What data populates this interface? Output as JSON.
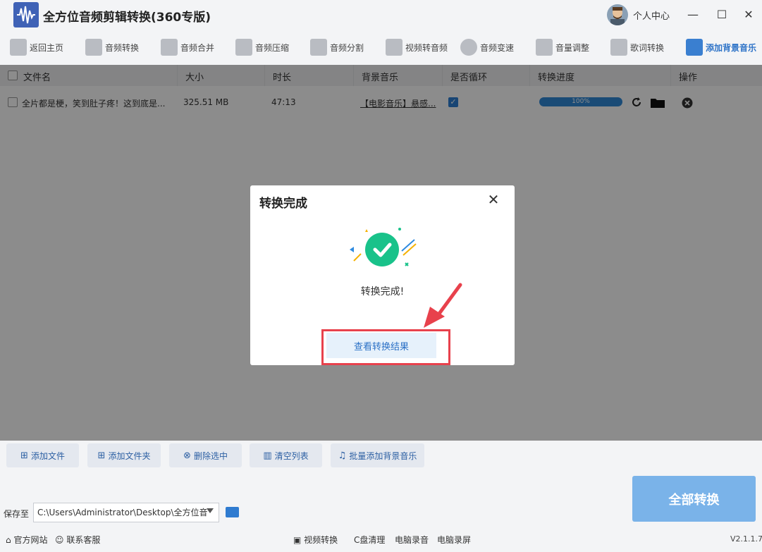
{
  "app": {
    "title": "全方位音频剪辑转换(360专版)",
    "user_center": "个人中心"
  },
  "toolbar": {
    "items": [
      "返回主页",
      "音频转换",
      "音频合并",
      "音频压缩",
      "音频分割",
      "视频转音频",
      "音频变速",
      "音量调整",
      "歌词转换",
      "添加背景音乐"
    ],
    "active_index": 9
  },
  "table": {
    "headers": [
      "文件名",
      "大小",
      "时长",
      "背景音乐",
      "是否循环",
      "转换进度",
      "操作"
    ],
    "rows": [
      {
        "name": "全片都是梗，笑到肚子疼！这到底是...",
        "size": "325.51 MB",
        "duration": "47:13",
        "bgm": "【电影音乐】悬感...",
        "loop": true,
        "progress": 100,
        "progress_label": "100%"
      }
    ]
  },
  "dialog": {
    "title": "转换完成",
    "message": "转换完成!",
    "button": "查看转换结果",
    "close": "✕"
  },
  "bottom": {
    "buttons": [
      "添加文件",
      "添加文件夹",
      "删除选中",
      "清空列表",
      "批量添加背景音乐"
    ],
    "save_label": "保存至",
    "save_path": "C:\\Users\\Administrator\\Desktop\\全方位音",
    "convert_all": "全部转换"
  },
  "footer": {
    "website": "官方网站",
    "support": "联系客服",
    "links": [
      "视频转换",
      "C盘清理",
      "电脑录音",
      "电脑录屏"
    ],
    "version": "V2.1.1.7"
  },
  "colors": {
    "accent": "#2f74c8",
    "success": "#19c28a",
    "highlight": "#e8414c"
  }
}
